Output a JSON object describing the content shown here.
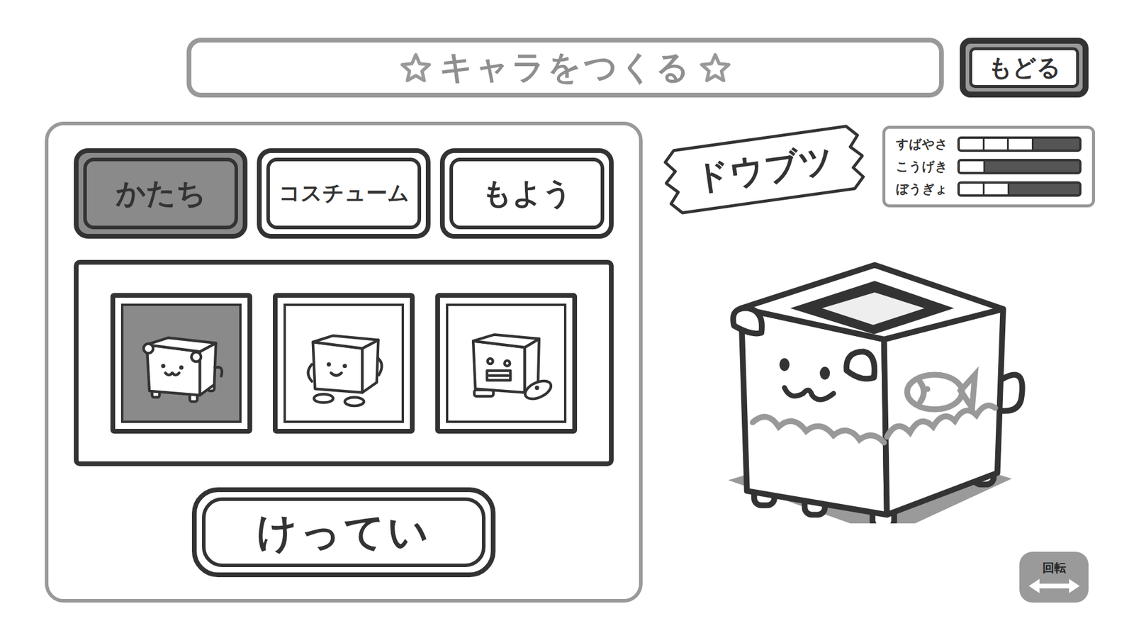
{
  "title": {
    "text": "キャラをつくる"
  },
  "back_button": "もどる",
  "tabs": [
    {
      "label": "かたち",
      "selected": true
    },
    {
      "label": "コスチューム",
      "selected": false
    },
    {
      "label": "もよう",
      "selected": false
    }
  ],
  "shapes": [
    {
      "kind": "animal",
      "selected": true
    },
    {
      "kind": "human",
      "selected": false
    },
    {
      "kind": "robot",
      "selected": false
    }
  ],
  "confirm_button": "けってい",
  "type_label": "ドウブツ",
  "stats": [
    {
      "name": "すばやさ",
      "level": 0.6
    },
    {
      "name": "こうげき",
      "level": 0.2
    },
    {
      "name": "ぼうぎょ",
      "level": 0.4
    }
  ],
  "rotate_button": {
    "label": "回転"
  }
}
